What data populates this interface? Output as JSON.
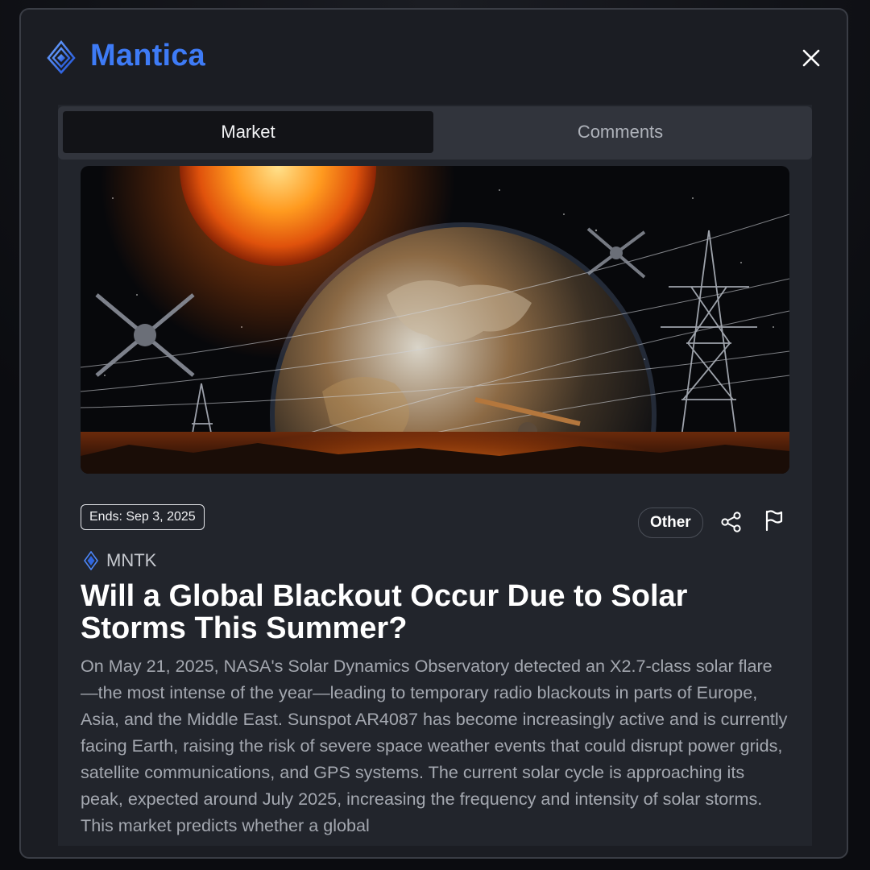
{
  "app": {
    "brand": "Mantica"
  },
  "tabs": [
    {
      "label": "Market",
      "active": true
    },
    {
      "label": "Comments",
      "active": false
    }
  ],
  "market": {
    "ends": "Ends: Sep 3, 2025",
    "category": "Other",
    "ticker": "MNTK",
    "title": "Will a Global Blackout Occur Due to Solar Storms This Summer?",
    "description": "On May 21, 2025, NASA's Solar Dynamics Observatory detected an X2.7-class solar flare—the most intense of the year—leading to temporary radio blackouts in parts of Europe, Asia, and the Middle East. Sunspot AR4087 has become increasingly active and is currently facing Earth, raising the risk of severe space weather events that could disrupt power grids, satellite communications, and GPS systems. The current solar cycle is approaching its peak, expected around July 2025, increasing the frequency and intensity of solar storms. This market predicts whether a global"
  },
  "icons": {
    "logo": "mantica-logo-icon",
    "close": "close-icon",
    "share": "share-icon",
    "flag": "flag-icon",
    "ticker": "mantica-token-icon"
  },
  "colors": {
    "brand": "#3e7bf6",
    "background": "#1b1d23",
    "panel": "#22252c",
    "active_tab": "#121317"
  }
}
